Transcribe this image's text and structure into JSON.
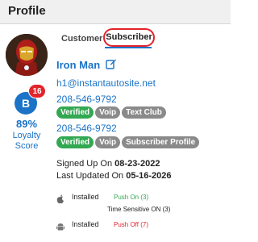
{
  "header": {
    "title": "Profile"
  },
  "tabs": [
    {
      "label": "Customer"
    },
    {
      "label": "Subscriber"
    }
  ],
  "profile": {
    "name": "Iron Man",
    "email": "h1@instantautosite.net",
    "phones": [
      {
        "number": "208-546-9792",
        "tags": [
          "Verified",
          "Voip",
          "Text Club"
        ]
      },
      {
        "number": "208-546-9792",
        "tags": [
          "Verified",
          "Voip",
          "Subscriber Profile"
        ]
      }
    ],
    "signed_up_label": "Signed Up On",
    "signed_up_date": "08-23-2022",
    "last_updated_label": "Last Updated On",
    "last_updated_date": "05-16-2026"
  },
  "loyalty": {
    "level": "B",
    "badge_count": "16",
    "percent": "89%",
    "label_line1": "Loyalty",
    "label_line2": "Score"
  },
  "devices": [
    {
      "icon": "apple-icon",
      "status": "Installed",
      "push": "Push On (3)",
      "extra": "Time Sensitive ON (3)"
    },
    {
      "icon": "android-icon",
      "status": "Installed",
      "push": "Push Off (7)"
    }
  ],
  "colors": {
    "accent": "#1b73c7",
    "verified": "#33a852",
    "tag": "#8a8a8a",
    "alert": "#e2242b"
  }
}
